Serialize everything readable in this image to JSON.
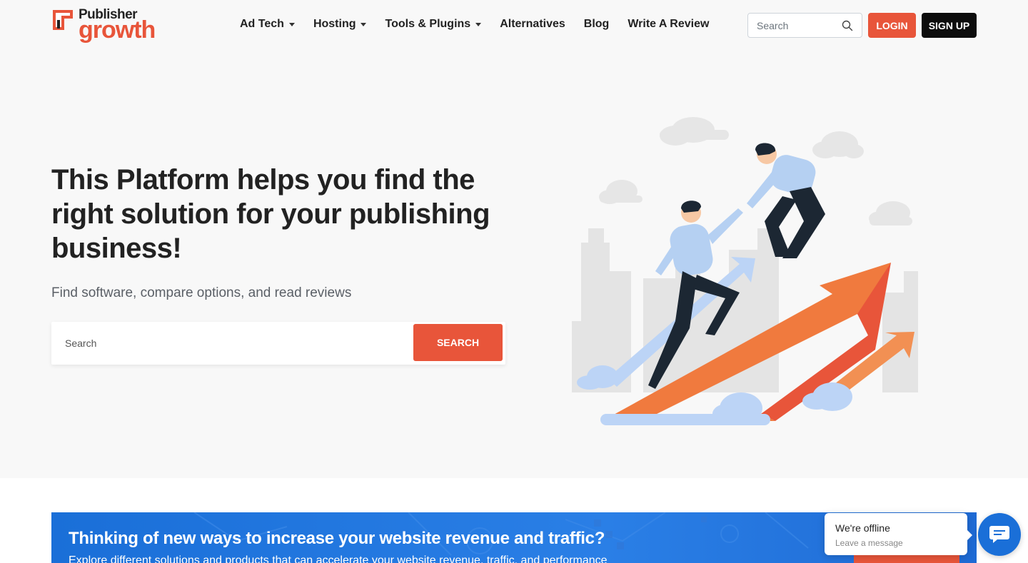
{
  "header": {
    "logo_top": "Publisher",
    "logo_bottom": "growth",
    "nav": [
      {
        "label": "Ad Tech",
        "dropdown": true
      },
      {
        "label": "Hosting",
        "dropdown": true
      },
      {
        "label": "Tools & Plugins",
        "dropdown": true
      },
      {
        "label": "Alternatives",
        "dropdown": false
      },
      {
        "label": "Blog",
        "dropdown": false
      },
      {
        "label": "Write A Review",
        "dropdown": false
      }
    ],
    "search_placeholder": "Search",
    "login_label": "LOGIN",
    "signup_label": "SIGN UP"
  },
  "hero": {
    "title": "This Platform helps you find the right solution for your publishing business!",
    "subtitle": "Find software, compare options, and read reviews",
    "search_placeholder": "Search",
    "search_button": "SEARCH"
  },
  "banner": {
    "title": "Thinking of new ways to increase your website revenue and traffic?",
    "subtitle": "Explore different solutions and products that can accelerate your website revenue, traffic, and performance"
  },
  "chat": {
    "status": "We're offline",
    "message": "Leave a message"
  },
  "colors": {
    "accent": "#e8553a",
    "dark": "#0d0d0d",
    "banner_blue": "#1a6fd8",
    "hero_bg": "#f8f8f8"
  },
  "icons": {
    "search": "search-icon",
    "caret": "caret-down-icon",
    "chat": "chat-bubble-icon",
    "logo": "logo-mark-icon"
  }
}
